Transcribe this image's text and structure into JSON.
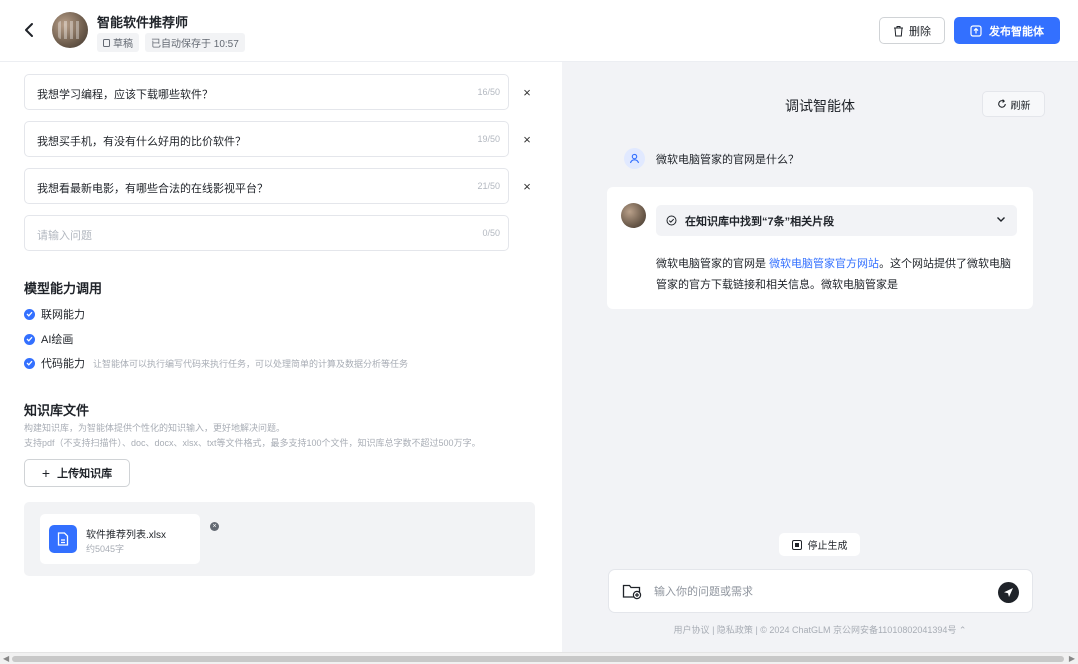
{
  "header": {
    "title": "智能软件推荐师",
    "tag_status": "草稿",
    "tag_saved": "已自动保存于 10:57",
    "delete_label": "删除",
    "publish_label": "发布智能体"
  },
  "questions": [
    {
      "text": "我想学习编程，应该下载哪些软件？",
      "count": "16/50"
    },
    {
      "text": "我想买手机，有没有什么好用的比价软件？",
      "count": "19/50"
    },
    {
      "text": "我想看最新电影，有哪些合法的在线影视平台？",
      "count": "21/50"
    },
    {
      "placeholder": "请输入问题",
      "count": "0/50"
    }
  ],
  "capabilities": {
    "title": "模型能力调用",
    "items": [
      {
        "label": "联网能力",
        "desc": ""
      },
      {
        "label": "AI绘画",
        "desc": ""
      },
      {
        "label": "代码能力",
        "desc": "让智能体可以执行编写代码来执行任务，可以处理简单的计算及数据分析等任务"
      }
    ]
  },
  "knowledge": {
    "title": "知识库文件",
    "desc1": "构建知识库，为智能体提供个性化的知识输入，更好地解决问题。",
    "desc2": "支持pdf（不支持扫描件）、doc、docx、xlsx、txt等文件格式，最多支持100个文件，知识库总字数不超过500万字。",
    "upload_label": "上传知识库",
    "file": {
      "name": "软件推荐列表.xlsx",
      "size": "约5045字"
    }
  },
  "debug": {
    "title": "调试智能体",
    "refresh_label": "刷新",
    "user_question": "微软电脑管家的官网是什么？",
    "kb_found": "在知识库中找到“7条”相关片段",
    "answer_prefix": "微软电脑管家的官网是 ",
    "answer_link": "微软电脑管家官方网站",
    "answer_suffix": "。这个网站提供了微软电脑管家的官方下载链接和相关信息。微软电脑管家是",
    "stop_label": "停止生成",
    "input_placeholder": "输入你的问题或需求",
    "footer_agreement": "用户协议",
    "footer_privacy": "隐私政策",
    "footer_copyright": "© 2024 ChatGLM 京公网安备11010802041394号"
  },
  "colors": {
    "accent": "#3370ff",
    "panel_bg": "#f2f3f6",
    "text": "#1f2329"
  }
}
